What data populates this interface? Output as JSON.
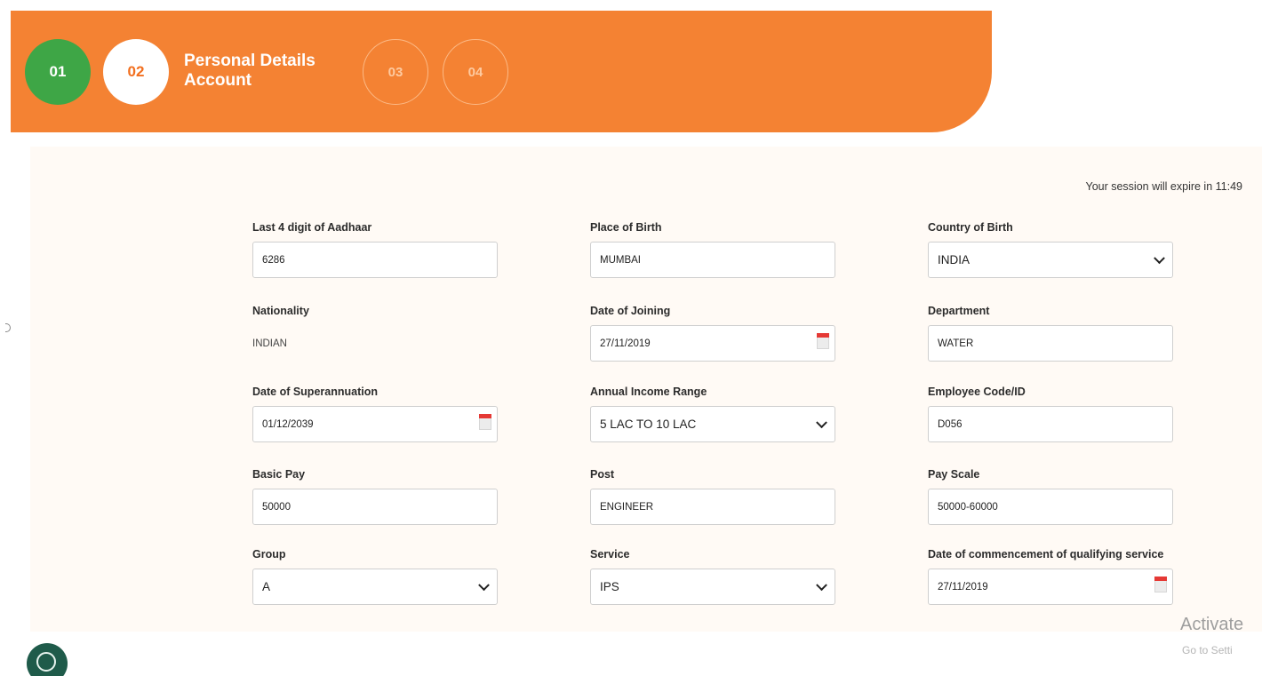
{
  "stepper": {
    "steps": [
      {
        "number": "01",
        "state": "completed",
        "color": "#3ea646"
      },
      {
        "number": "02",
        "state": "active",
        "color": "#ffffff"
      },
      {
        "number": "03",
        "state": "upcoming"
      },
      {
        "number": "04",
        "state": "upcoming"
      }
    ],
    "active_title_line1": "Personal Details",
    "active_title_line2": "Account",
    "header_color": "#f48233"
  },
  "session": {
    "text": "Your session will expire in 11:49"
  },
  "form": {
    "aadhaar": {
      "label": "Last 4 digit of Aadhaar",
      "value": "6286"
    },
    "place_of_birth": {
      "label": "Place of Birth",
      "value": "MUMBAI"
    },
    "country_of_birth": {
      "label": "Country of Birth",
      "value": "INDIA"
    },
    "nationality": {
      "label": "Nationality",
      "value": "INDIAN"
    },
    "date_of_joining": {
      "label": "Date of Joining",
      "value": "27/11/2019"
    },
    "department": {
      "label": "Department",
      "value": "WATER"
    },
    "date_of_superannuation": {
      "label": "Date of Superannuation",
      "value": "01/12/2039"
    },
    "annual_income_range": {
      "label": "Annual Income Range",
      "value": "5 LAC TO 10 LAC"
    },
    "employee_code": {
      "label": "Employee Code/ID",
      "value": "D056"
    },
    "basic_pay": {
      "label": "Basic Pay",
      "value": "50000"
    },
    "post": {
      "label": "Post",
      "value": "ENGINEER"
    },
    "pay_scale": {
      "label": "Pay Scale",
      "value": "50000-60000"
    },
    "group": {
      "label": "Group",
      "value": "A"
    },
    "service": {
      "label": "Service",
      "value": "IPS"
    },
    "qualifying_service_date": {
      "label": "Date of commencement of qualifying service",
      "value": "27/11/2019"
    }
  },
  "watermark": {
    "title": "Activate",
    "subtitle": "Go to Setti"
  }
}
